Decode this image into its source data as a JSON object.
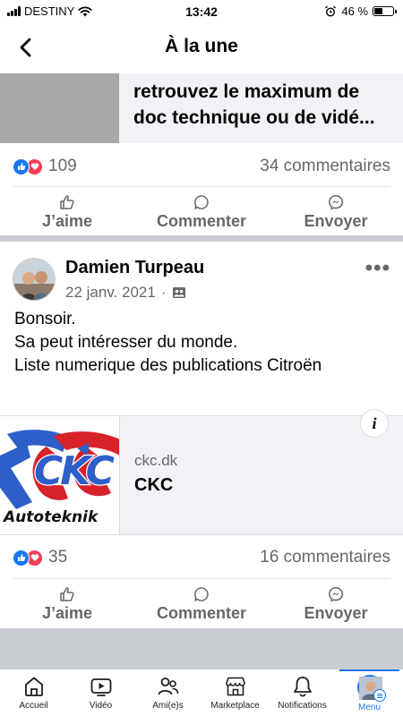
{
  "status_bar": {
    "carrier": "DESTINY",
    "time": "13:42",
    "battery": "46 %",
    "battery_level": 0.46
  },
  "header": {
    "title": "À la une"
  },
  "top_post": {
    "link_lines": [
      "retrouvez le maximum de",
      "doc technique ou de vidé..."
    ],
    "reaction_count": "109",
    "comments": "34 commentaires",
    "actions": {
      "like": "J’aime",
      "comment": "Commenter",
      "send": "Envoyer"
    }
  },
  "post": {
    "author": "Damien Turpeau",
    "date": "22 janv. 2021",
    "dot": "·",
    "more": "•••",
    "body": [
      "Bonsoir.",
      "Sa peut intéresser du monde.",
      "Liste numerique des publications Citroën"
    ],
    "link": {
      "logo_text": "CKC",
      "logo_subtext": "Autoteknik",
      "domain": "ckc.dk",
      "title": "CKC",
      "info": "i"
    },
    "reaction_count": "35",
    "comments": "16 commentaires",
    "actions": {
      "like": "J’aime",
      "comment": "Commenter",
      "send": "Envoyer"
    }
  },
  "tabbar": {
    "items": [
      {
        "label": "Accueil",
        "icon": "home-icon"
      },
      {
        "label": "Vidéo",
        "icon": "video-icon"
      },
      {
        "label": "Ami(e)s",
        "icon": "friends-icon"
      },
      {
        "label": "Marketplace",
        "icon": "marketplace-icon"
      },
      {
        "label": "Notifications",
        "icon": "bell-icon"
      },
      {
        "label": "Menu",
        "icon": "menu-avatar"
      }
    ],
    "active": "Menu"
  },
  "colors": {
    "accent": "#1877f2",
    "love": "#f33e58",
    "muted": "#65676b",
    "separator": "#c9ccd1"
  }
}
